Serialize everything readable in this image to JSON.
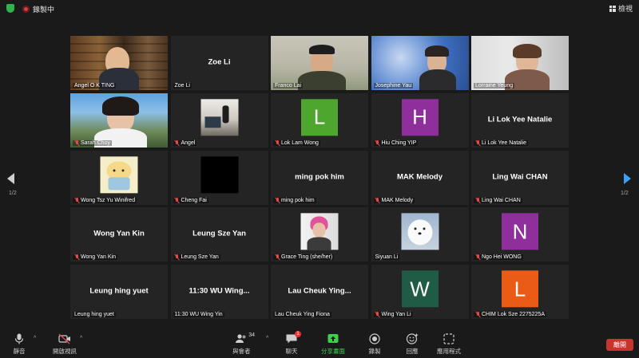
{
  "top_bar": {
    "recording_label": "錄製中",
    "view_label": "檢視"
  },
  "navigation": {
    "page_left": "1/2",
    "page_right": "1/2"
  },
  "participants": [
    {
      "name": "Angel O K TING",
      "display": "video",
      "muted": false
    },
    {
      "name": "Zoe Li",
      "display": "name",
      "center_text": "Zoe Li",
      "muted": false
    },
    {
      "name": "Franco Lai",
      "display": "video",
      "muted": false,
      "active_speaker": true
    },
    {
      "name": "Josephine Yau",
      "display": "video",
      "muted": false
    },
    {
      "name": "Lorraine Yeung",
      "display": "video",
      "muted": false
    },
    {
      "name": "Sarah Choy",
      "display": "video",
      "muted": true
    },
    {
      "name": "Angel",
      "display": "image",
      "muted": true
    },
    {
      "name": "Lok Lam Wong",
      "display": "avatar",
      "initial": "L",
      "color": "#4fa62f",
      "muted": true
    },
    {
      "name": "Hiu Ching YIP",
      "display": "avatar",
      "initial": "H",
      "color": "#8e2f9c",
      "muted": true
    },
    {
      "name": "Li Lok Yee Natalie",
      "display": "name",
      "center_text": "Li Lok Yee Natalie",
      "muted": true
    },
    {
      "name": "Wong Tsz Yu Winifred",
      "display": "image",
      "muted": true
    },
    {
      "name": "Cheng Fai",
      "display": "image",
      "muted": true
    },
    {
      "name": "ming pok him",
      "display": "name",
      "center_text": "ming pok him",
      "muted": true
    },
    {
      "name": "MAK Melody",
      "display": "name",
      "center_text": "MAK Melody",
      "muted": true
    },
    {
      "name": "Ling Wai CHAN",
      "display": "name",
      "center_text": "Ling Wai CHAN",
      "muted": true
    },
    {
      "name": "Wong Yan Kin",
      "display": "name",
      "center_text": "Wong Yan Kin",
      "muted": true
    },
    {
      "name": "Leung Sze Yan",
      "display": "name",
      "center_text": "Leung Sze Yan",
      "muted": true
    },
    {
      "name": "Grace Ting (she/her)",
      "display": "image",
      "muted": true
    },
    {
      "name": "Siyuan Li",
      "display": "image",
      "muted": true
    },
    {
      "name": "Ngo Hei WONG",
      "display": "avatar",
      "initial": "N",
      "color": "#8e2f9c",
      "muted": true
    },
    {
      "name": "Leung hing yuet",
      "display": "name",
      "center_text": "Leung hing yuet",
      "muted": false
    },
    {
      "name": "11:30 WU Wing Yin",
      "display": "name",
      "center_text": "11:30 WU Wing...",
      "muted": false
    },
    {
      "name": "Lau Cheuk Ying Fiona",
      "display": "name",
      "center_text": "Lau Cheuk Ying...",
      "muted": false
    },
    {
      "name": "Wing Yan Li",
      "display": "avatar",
      "initial": "W",
      "color": "#1f5b45",
      "muted": true
    },
    {
      "name": "CHIM Lok Sze 2275225A",
      "display": "avatar",
      "initial": "L",
      "color": "#ea5b16",
      "muted": true
    }
  ],
  "toolbar": {
    "mute": "靜音",
    "video": "開啟視訊",
    "participants": "與會者",
    "participant_count": "34",
    "chat": "聊天",
    "chat_badge": "1",
    "share": "分享畫面",
    "record": "錄製",
    "reactions": "回應",
    "apps": "應用程式",
    "end": "離開"
  },
  "colors": {
    "share_green": "#3ecf4c",
    "end_red": "#c8352e",
    "active_outline": "#f3e479",
    "nav_blue": "#3aa0f5"
  }
}
